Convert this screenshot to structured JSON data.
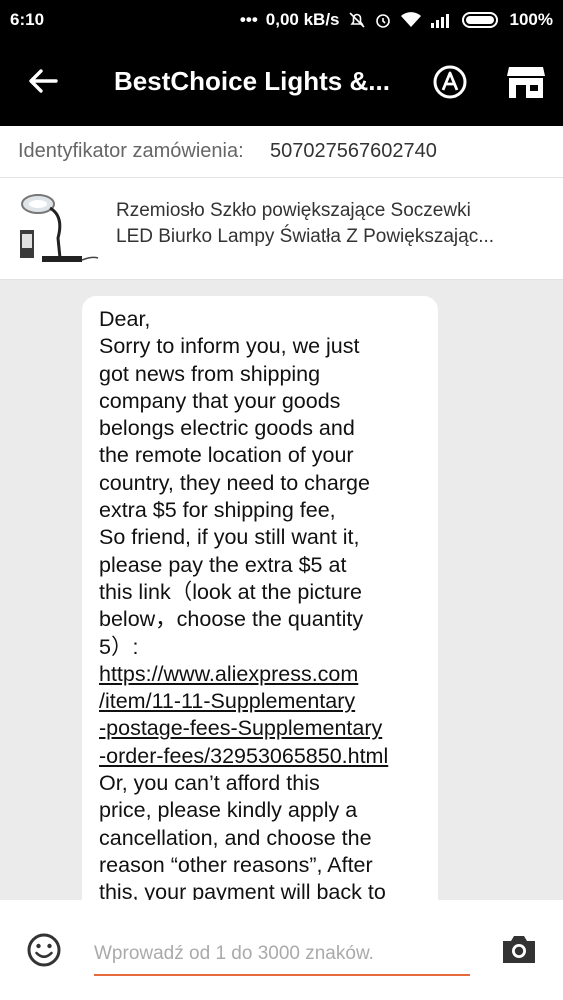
{
  "status_bar": {
    "time": "6:10",
    "network_speed": "0,00 kB/s",
    "battery": "100%"
  },
  "app_bar": {
    "title": "BestChoice Lights &...",
    "icons": [
      "back-arrow-icon",
      "translate-icon",
      "store-icon"
    ]
  },
  "order": {
    "label": "Identyfikator zamówienia:",
    "number": "507027567602740"
  },
  "product": {
    "title_lines": [
      "Rzemiosło Szkło powiększające Soczewki",
      "LED Biurko Lampy Światła Z Powiększając..."
    ]
  },
  "message": {
    "lines": [
      "Dear,",
      "Sorry to inform you, we just",
      "got news from shipping",
      "company that your goods",
      "belongs electric goods and",
      "the remote location of your",
      "country, they need to charge",
      "extra $5 for shipping fee,",
      "So friend, if you still want it,",
      "please pay the extra $5 at",
      "this link（look at the picture",
      "below，choose the quantity",
      "5）:",
      "https://www.aliexpress.com",
      "/item/11-11-Supplementary",
      "-postage-fees-Supplementary",
      "-order-fees/32953065850.html",
      "Or, you can’t afford this",
      "price, please kindly apply a",
      "cancellation, and choose the",
      "reason “other reasons”, After",
      "this, your payment will back to"
    ]
  },
  "input_bar": {
    "placeholder": "Wprowadź od 1 do 3000 znaków.",
    "value": ""
  },
  "colors": {
    "bar_background": "#000000",
    "chat_background": "#ebebeb",
    "accent_underline": "#e66a3c"
  }
}
